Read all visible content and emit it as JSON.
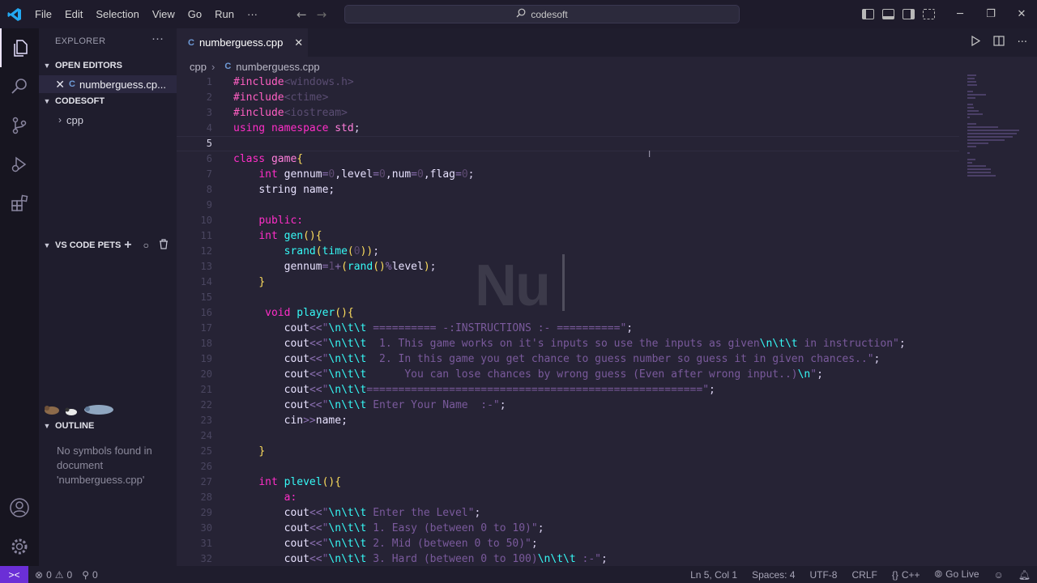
{
  "window": {
    "search_text": "codesoft",
    "menu": [
      "File",
      "Edit",
      "Selection",
      "View",
      "Go",
      "Run",
      "···"
    ]
  },
  "sidebar": {
    "title": "EXPLORER",
    "more": "···",
    "open_editors_label": "OPEN EDITORS",
    "open_editor_file": "numberguess.cp...",
    "folder_label": "CODESOFT",
    "folder_item": "cpp",
    "pets_label": "VS CODE PETS",
    "outline_label": "OUTLINE",
    "outline_message": "No symbols found in document 'numberguess.cpp'"
  },
  "tab": {
    "label": "numberguess.cpp"
  },
  "breadcrumb": {
    "folder": "cpp",
    "file": "numberguess.cpp"
  },
  "editor": {
    "watermark": "Nu",
    "lines": [
      {
        "n": "1",
        "tokens": [
          [
            "t-pre",
            "#include"
          ],
          [
            "t-inc",
            "<windows.h>"
          ]
        ]
      },
      {
        "n": "2",
        "tokens": [
          [
            "t-pre",
            "#include"
          ],
          [
            "t-inc",
            "<ctime>"
          ]
        ]
      },
      {
        "n": "3",
        "tokens": [
          [
            "t-pre",
            "#include"
          ],
          [
            "t-inc",
            "<iostream>"
          ]
        ]
      },
      {
        "n": "4",
        "tokens": [
          [
            "t-kwp",
            "using namespace "
          ],
          [
            "t-type",
            "std"
          ],
          [
            "t-pun",
            ";"
          ]
        ]
      },
      {
        "n": "5",
        "tokens": []
      },
      {
        "n": "6",
        "tokens": [
          [
            "t-kwp",
            "class "
          ],
          [
            "t-type",
            "game"
          ],
          [
            "t-br",
            "{"
          ]
        ]
      },
      {
        "n": "7",
        "tokens": [
          [
            "t-pun",
            "    "
          ],
          [
            "t-kwp",
            "int "
          ],
          [
            "t-id",
            "gennum"
          ],
          [
            "t-op",
            "="
          ],
          [
            "t-num",
            "0"
          ],
          [
            "t-id",
            ",level"
          ],
          [
            "t-op",
            "="
          ],
          [
            "t-num",
            "0"
          ],
          [
            "t-id",
            ",num"
          ],
          [
            "t-op",
            "="
          ],
          [
            "t-num",
            "0"
          ],
          [
            "t-id",
            ",flag"
          ],
          [
            "t-op",
            "="
          ],
          [
            "t-num",
            "0"
          ],
          [
            "t-pun",
            ";"
          ]
        ]
      },
      {
        "n": "8",
        "tokens": [
          [
            "t-pun",
            "    "
          ],
          [
            "t-id",
            "string name;"
          ]
        ]
      },
      {
        "n": "9",
        "tokens": []
      },
      {
        "n": "10",
        "tokens": [
          [
            "t-pun",
            "    "
          ],
          [
            "t-kwp",
            "public:"
          ]
        ]
      },
      {
        "n": "11",
        "tokens": [
          [
            "t-pun",
            "    "
          ],
          [
            "t-kwp",
            "int "
          ],
          [
            "t-fn",
            "gen"
          ],
          [
            "t-br",
            "(){"
          ]
        ]
      },
      {
        "n": "12",
        "tokens": [
          [
            "t-pun",
            "        "
          ],
          [
            "t-fn",
            "srand"
          ],
          [
            "t-br",
            "("
          ],
          [
            "t-fn",
            "time"
          ],
          [
            "t-br",
            "("
          ],
          [
            "t-num",
            "0"
          ],
          [
            "t-br",
            "))"
          ],
          [
            "t-pun",
            ";"
          ]
        ]
      },
      {
        "n": "13",
        "tokens": [
          [
            "t-pun",
            "        "
          ],
          [
            "t-id",
            "gennum"
          ],
          [
            "t-op",
            "="
          ],
          [
            "t-num",
            "1"
          ],
          [
            "t-op",
            "+"
          ],
          [
            "t-br",
            "("
          ],
          [
            "t-fn",
            "rand"
          ],
          [
            "t-br",
            "()"
          ],
          [
            "t-op",
            "%"
          ],
          [
            "t-id",
            "level"
          ],
          [
            "t-br",
            ")"
          ],
          [
            "t-pun",
            ";"
          ]
        ]
      },
      {
        "n": "14",
        "tokens": [
          [
            "t-pun",
            "    "
          ],
          [
            "t-br",
            "}"
          ]
        ]
      },
      {
        "n": "15",
        "tokens": []
      },
      {
        "n": "16",
        "tokens": [
          [
            "t-pun",
            "     "
          ],
          [
            "t-kwp",
            "void "
          ],
          [
            "t-fn",
            "player"
          ],
          [
            "t-br",
            "(){"
          ]
        ]
      },
      {
        "n": "17",
        "tokens": [
          [
            "t-pun",
            "        "
          ],
          [
            "t-id",
            "cout"
          ],
          [
            "t-op",
            "<<"
          ],
          [
            "t-str",
            "\""
          ],
          [
            "t-esc",
            "\\n\\t\\t"
          ],
          [
            "t-str",
            " ========== -:INSTRUCTIONS :- ==========\""
          ],
          [
            "t-pun",
            ";"
          ]
        ]
      },
      {
        "n": "18",
        "tokens": [
          [
            "t-pun",
            "        "
          ],
          [
            "t-id",
            "cout"
          ],
          [
            "t-op",
            "<<"
          ],
          [
            "t-str",
            "\""
          ],
          [
            "t-esc",
            "\\n\\t\\t"
          ],
          [
            "t-str",
            "  1. This game works on it's inputs so use the inputs as given"
          ],
          [
            "t-esc",
            "\\n\\t\\t"
          ],
          [
            "t-str",
            " in instruction\""
          ],
          [
            "t-pun",
            ";"
          ]
        ]
      },
      {
        "n": "19",
        "tokens": [
          [
            "t-pun",
            "        "
          ],
          [
            "t-id",
            "cout"
          ],
          [
            "t-op",
            "<<"
          ],
          [
            "t-str",
            "\""
          ],
          [
            "t-esc",
            "\\n\\t\\t"
          ],
          [
            "t-str",
            "  2. In this game you get chance to guess number so guess it in given chances..\""
          ],
          [
            "t-pun",
            ";"
          ]
        ]
      },
      {
        "n": "20",
        "tokens": [
          [
            "t-pun",
            "        "
          ],
          [
            "t-id",
            "cout"
          ],
          [
            "t-op",
            "<<"
          ],
          [
            "t-str",
            "\""
          ],
          [
            "t-esc",
            "\\n\\t\\t"
          ],
          [
            "t-str",
            "      You can lose chances by wrong guess (Even after wrong input..)"
          ],
          [
            "t-esc",
            "\\n"
          ],
          [
            "t-str",
            "\""
          ],
          [
            "t-pun",
            ";"
          ]
        ]
      },
      {
        "n": "21",
        "tokens": [
          [
            "t-pun",
            "        "
          ],
          [
            "t-id",
            "cout"
          ],
          [
            "t-op",
            "<<"
          ],
          [
            "t-str",
            "\""
          ],
          [
            "t-esc",
            "\\n\\t\\t"
          ],
          [
            "t-str",
            "=====================================================\""
          ],
          [
            "t-pun",
            ";"
          ]
        ]
      },
      {
        "n": "22",
        "tokens": [
          [
            "t-pun",
            "        "
          ],
          [
            "t-id",
            "cout"
          ],
          [
            "t-op",
            "<<"
          ],
          [
            "t-str",
            "\""
          ],
          [
            "t-esc",
            "\\n\\t\\t"
          ],
          [
            "t-str",
            " Enter Your Name  :-\""
          ],
          [
            "t-pun",
            ";"
          ]
        ]
      },
      {
        "n": "23",
        "tokens": [
          [
            "t-pun",
            "        "
          ],
          [
            "t-id",
            "cin"
          ],
          [
            "t-op",
            ">>"
          ],
          [
            "t-id",
            "name;"
          ]
        ]
      },
      {
        "n": "24",
        "tokens": []
      },
      {
        "n": "25",
        "tokens": [
          [
            "t-pun",
            "    "
          ],
          [
            "t-br",
            "}"
          ]
        ]
      },
      {
        "n": "26",
        "tokens": []
      },
      {
        "n": "27",
        "tokens": [
          [
            "t-pun",
            "    "
          ],
          [
            "t-kwp",
            "int "
          ],
          [
            "t-fn",
            "plevel"
          ],
          [
            "t-br",
            "(){"
          ]
        ]
      },
      {
        "n": "28",
        "tokens": [
          [
            "t-pun",
            "        "
          ],
          [
            "t-kwp",
            "a:"
          ]
        ]
      },
      {
        "n": "29",
        "tokens": [
          [
            "t-pun",
            "        "
          ],
          [
            "t-id",
            "cout"
          ],
          [
            "t-op",
            "<<"
          ],
          [
            "t-str",
            "\""
          ],
          [
            "t-esc",
            "\\n\\t\\t"
          ],
          [
            "t-str",
            " Enter the Level\""
          ],
          [
            "t-pun",
            ";"
          ]
        ]
      },
      {
        "n": "30",
        "tokens": [
          [
            "t-pun",
            "        "
          ],
          [
            "t-id",
            "cout"
          ],
          [
            "t-op",
            "<<"
          ],
          [
            "t-str",
            "\""
          ],
          [
            "t-esc",
            "\\n\\t\\t"
          ],
          [
            "t-str",
            " 1. Easy (between 0 to 10)\""
          ],
          [
            "t-pun",
            ";"
          ]
        ]
      },
      {
        "n": "31",
        "tokens": [
          [
            "t-pun",
            "        "
          ],
          [
            "t-id",
            "cout"
          ],
          [
            "t-op",
            "<<"
          ],
          [
            "t-str",
            "\""
          ],
          [
            "t-esc",
            "\\n\\t\\t"
          ],
          [
            "t-str",
            " 2. Mid (between 0 to 50)\""
          ],
          [
            "t-pun",
            ";"
          ]
        ]
      },
      {
        "n": "32",
        "tokens": [
          [
            "t-pun",
            "        "
          ],
          [
            "t-id",
            "cout"
          ],
          [
            "t-op",
            "<<"
          ],
          [
            "t-str",
            "\""
          ],
          [
            "t-esc",
            "\\n\\t\\t"
          ],
          [
            "t-str",
            " 3. Hard (between 0 to 100)"
          ],
          [
            "t-esc",
            "\\n\\t\\t"
          ],
          [
            "t-str",
            " :-\""
          ],
          [
            "t-pun",
            ";"
          ]
        ]
      }
    ]
  },
  "status": {
    "remote": "><",
    "errors": "0",
    "warnings": "0",
    "ports": "0",
    "position": "Ln 5, Col 1",
    "spaces": "Spaces: 4",
    "encoding": "UTF-8",
    "eol": "CRLF",
    "language": "C++",
    "golive": "Go Live"
  },
  "colors": {
    "accent": "#6b2fd6",
    "editor_bg": "#262335",
    "sidebar_bg": "#1f1d2d"
  }
}
